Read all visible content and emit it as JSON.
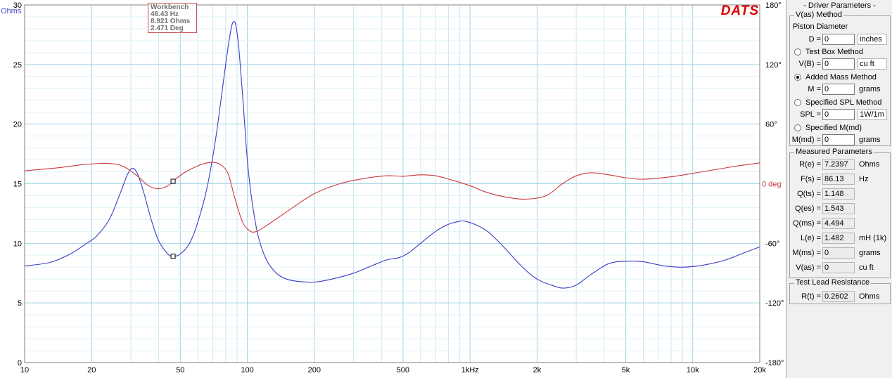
{
  "chart_data": {
    "type": "line",
    "x_scale": "log",
    "xlim": [
      10,
      20000
    ],
    "x_ticks": [
      {
        "v": 10,
        "label": "10"
      },
      {
        "v": 20,
        "label": "20"
      },
      {
        "v": 50,
        "label": "50"
      },
      {
        "v": 100,
        "label": "100"
      },
      {
        "v": 200,
        "label": "200"
      },
      {
        "v": 500,
        "label": "500"
      },
      {
        "v": 1000,
        "label": "1kHz"
      },
      {
        "v": 2000,
        "label": "2k"
      },
      {
        "v": 5000,
        "label": "5k"
      },
      {
        "v": 10000,
        "label": "10k"
      },
      {
        "v": 20000,
        "label": "20k"
      }
    ],
    "y_left": {
      "label": "Ohms",
      "lim": [
        0,
        30
      ],
      "ticks": [
        "0",
        "5",
        "10",
        "15",
        "20",
        "25",
        "30"
      ]
    },
    "y_right": {
      "label": "0 deg",
      "lim": [
        -180,
        180
      ],
      "ticks": [
        "180°",
        "120°",
        "60°",
        "-60°",
        "-120°",
        "-180°"
      ]
    },
    "grid": true,
    "series": [
      {
        "color": "#3c3cc8",
        "axis": "left",
        "points": [
          [
            10,
            8.1
          ],
          [
            13,
            8.4
          ],
          [
            16,
            9.1
          ],
          [
            19,
            10.0
          ],
          [
            21,
            10.6
          ],
          [
            24,
            12.0
          ],
          [
            27,
            14.3
          ],
          [
            29,
            15.8
          ],
          [
            30.5,
            16.3
          ],
          [
            32,
            15.9
          ],
          [
            34,
            14.5
          ],
          [
            37,
            12.0
          ],
          [
            40,
            10.2
          ],
          [
            44,
            9.1
          ],
          [
            46.43,
            8.92
          ],
          [
            50,
            9.1
          ],
          [
            55,
            10.0
          ],
          [
            60,
            11.8
          ],
          [
            66,
            14.7
          ],
          [
            72,
            18.7
          ],
          [
            78,
            23.5
          ],
          [
            82,
            26.5
          ],
          [
            85,
            28.2
          ],
          [
            87,
            28.6
          ],
          [
            89,
            28.2
          ],
          [
            92,
            26.0
          ],
          [
            96,
            21.5
          ],
          [
            100,
            17.0
          ],
          [
            105,
            13.5
          ],
          [
            112,
            10.6
          ],
          [
            122,
            8.6
          ],
          [
            135,
            7.5
          ],
          [
            150,
            7.0
          ],
          [
            170,
            6.8
          ],
          [
            200,
            6.75
          ],
          [
            240,
            7.0
          ],
          [
            300,
            7.5
          ],
          [
            360,
            8.1
          ],
          [
            420,
            8.6
          ],
          [
            480,
            8.8
          ],
          [
            530,
            9.2
          ],
          [
            600,
            10.0
          ],
          [
            700,
            11.0
          ],
          [
            800,
            11.6
          ],
          [
            900,
            11.85
          ],
          [
            950,
            11.85
          ],
          [
            1050,
            11.6
          ],
          [
            1200,
            11.0
          ],
          [
            1400,
            9.8
          ],
          [
            1700,
            8.1
          ],
          [
            2000,
            7.0
          ],
          [
            2400,
            6.4
          ],
          [
            2650,
            6.25
          ],
          [
            3000,
            6.5
          ],
          [
            3500,
            7.4
          ],
          [
            4200,
            8.3
          ],
          [
            5000,
            8.5
          ],
          [
            6000,
            8.45
          ],
          [
            7500,
            8.1
          ],
          [
            9000,
            8.0
          ],
          [
            11000,
            8.15
          ],
          [
            14000,
            8.6
          ],
          [
            17000,
            9.2
          ],
          [
            20000,
            9.7
          ]
        ]
      },
      {
        "color": "#c8373a",
        "axis": "right",
        "points": [
          [
            10,
            13
          ],
          [
            14,
            16
          ],
          [
            18,
            19
          ],
          [
            22,
            20.5
          ],
          [
            25,
            20
          ],
          [
            28,
            17
          ],
          [
            32,
            8
          ],
          [
            36,
            -2
          ],
          [
            40,
            -5
          ],
          [
            44,
            -2
          ],
          [
            46.43,
            2.471
          ],
          [
            52,
            11
          ],
          [
            60,
            18
          ],
          [
            66,
            21
          ],
          [
            71,
            21.5
          ],
          [
            76,
            19
          ],
          [
            82,
            10
          ],
          [
            88,
            -15
          ],
          [
            95,
            -38
          ],
          [
            102,
            -47
          ],
          [
            110,
            -48
          ],
          [
            130,
            -38
          ],
          [
            160,
            -24
          ],
          [
            200,
            -10
          ],
          [
            260,
            0
          ],
          [
            330,
            5
          ],
          [
            420,
            8
          ],
          [
            500,
            7.5
          ],
          [
            600,
            9
          ],
          [
            700,
            8
          ],
          [
            850,
            3
          ],
          [
            1000,
            -2
          ],
          [
            1200,
            -9
          ],
          [
            1500,
            -14
          ],
          [
            1800,
            -15.5
          ],
          [
            2200,
            -12
          ],
          [
            2600,
            0
          ],
          [
            3000,
            8
          ],
          [
            3500,
            11
          ],
          [
            4200,
            9
          ],
          [
            5000,
            6
          ],
          [
            6000,
            4.5
          ],
          [
            8000,
            7
          ],
          [
            11000,
            12
          ],
          [
            15000,
            17
          ],
          [
            20000,
            21
          ]
        ]
      }
    ]
  },
  "cursor": {
    "title": "Workbench",
    "freq": "46.43 Hz",
    "ohms": "8.921 Ohms",
    "deg": "2.471 Deg",
    "x": 46.43,
    "ohms_val": 8.921,
    "deg_val": 2.471
  },
  "brand": "DATS",
  "panel": {
    "title": "- Driver Parameters -",
    "vas_title": "V(as) Method",
    "piston_label": "Piston Diameter",
    "d_label": "D =",
    "d_value": "0",
    "d_unit": "inches",
    "test_box_label": "Test Box Method",
    "vb_label": "V(B) =",
    "vb_value": "0",
    "vb_unit": "cu ft",
    "added_mass_label": "Added Mass Method",
    "m_label": "M =",
    "m_value": "0",
    "m_unit": "grams",
    "spl_method_label": "Specified SPL Method",
    "spl_label": "SPL =",
    "spl_value": "0",
    "spl_unit": "1W/1m",
    "mmd_method_label": "Specified M(md)",
    "mmd_label": "M(md) =",
    "mmd_value": "0",
    "mmd_unit": "grams",
    "selected_method": "Added Mass Method",
    "measured_title": "Measured Parameters",
    "measured": [
      {
        "label": "R(e) =",
        "value": "7.2397",
        "unit": "Ohms"
      },
      {
        "label": "F(s) =",
        "value": "86.13",
        "unit": "Hz"
      },
      {
        "label": "Q(ts) =",
        "value": "1.148",
        "unit": ""
      },
      {
        "label": "Q(es) =",
        "value": "1.543",
        "unit": ""
      },
      {
        "label": "Q(ms) =",
        "value": "4.494",
        "unit": ""
      },
      {
        "label": "L(e) =",
        "value": "1.482",
        "unit": "mH (1k)"
      },
      {
        "label": "M(ms) =",
        "value": "0",
        "unit": "grams"
      },
      {
        "label": "V(as) =",
        "value": "0",
        "unit": "cu ft"
      }
    ],
    "lead_title": "Test Lead Resistance",
    "rt_label": "R(t) =",
    "rt_value": "0.2602",
    "rt_unit": "Ohms"
  }
}
